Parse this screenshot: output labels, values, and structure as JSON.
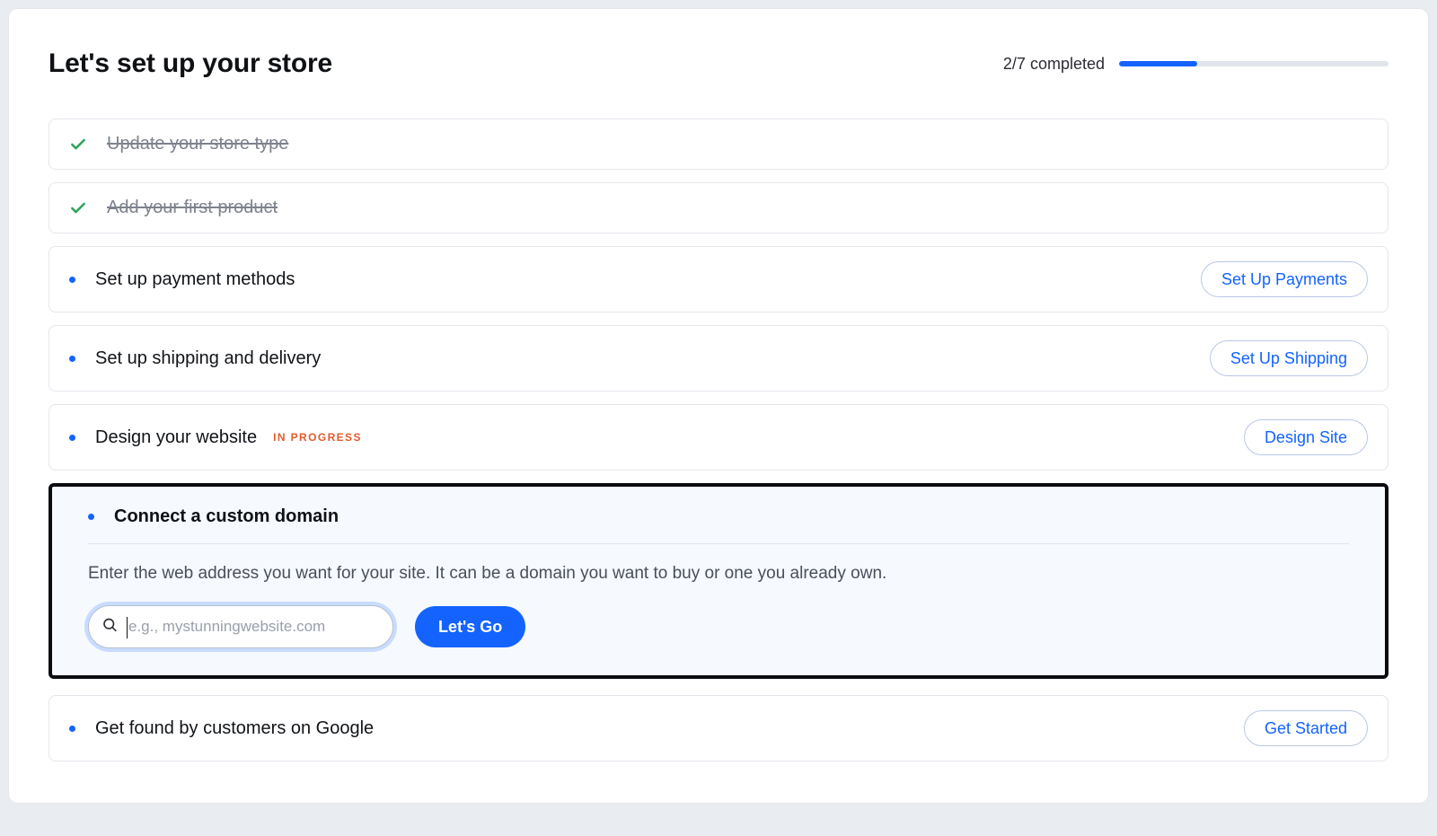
{
  "header": {
    "title": "Let's set up your store"
  },
  "progress": {
    "text": "2/7 completed",
    "percent": 29
  },
  "tasks": [
    {
      "status": "done",
      "label": "Update your store type"
    },
    {
      "status": "done",
      "label": "Add your first product"
    },
    {
      "status": "todo",
      "label": "Set up payment methods",
      "action_label": "Set Up Payments"
    },
    {
      "status": "todo",
      "label": "Set up shipping and delivery",
      "action_label": "Set Up Shipping"
    },
    {
      "status": "inprogress",
      "label": "Design your website",
      "badge": "IN PROGRESS",
      "action_label": "Design Site"
    },
    {
      "status": "expanded",
      "label": "Connect a custom domain",
      "help_text": "Enter the web address you want for your site. It can be a domain you want to buy or one you already own.",
      "domain_input": {
        "placeholder": "e.g., mystunningwebsite.com",
        "value": ""
      },
      "primary_action_label": "Let's Go"
    },
    {
      "status": "todo",
      "label": "Get found by customers on Google",
      "action_label": "Get Started"
    }
  ],
  "colors": {
    "accent": "#1463ff",
    "inprogress": "#e25b2e"
  }
}
